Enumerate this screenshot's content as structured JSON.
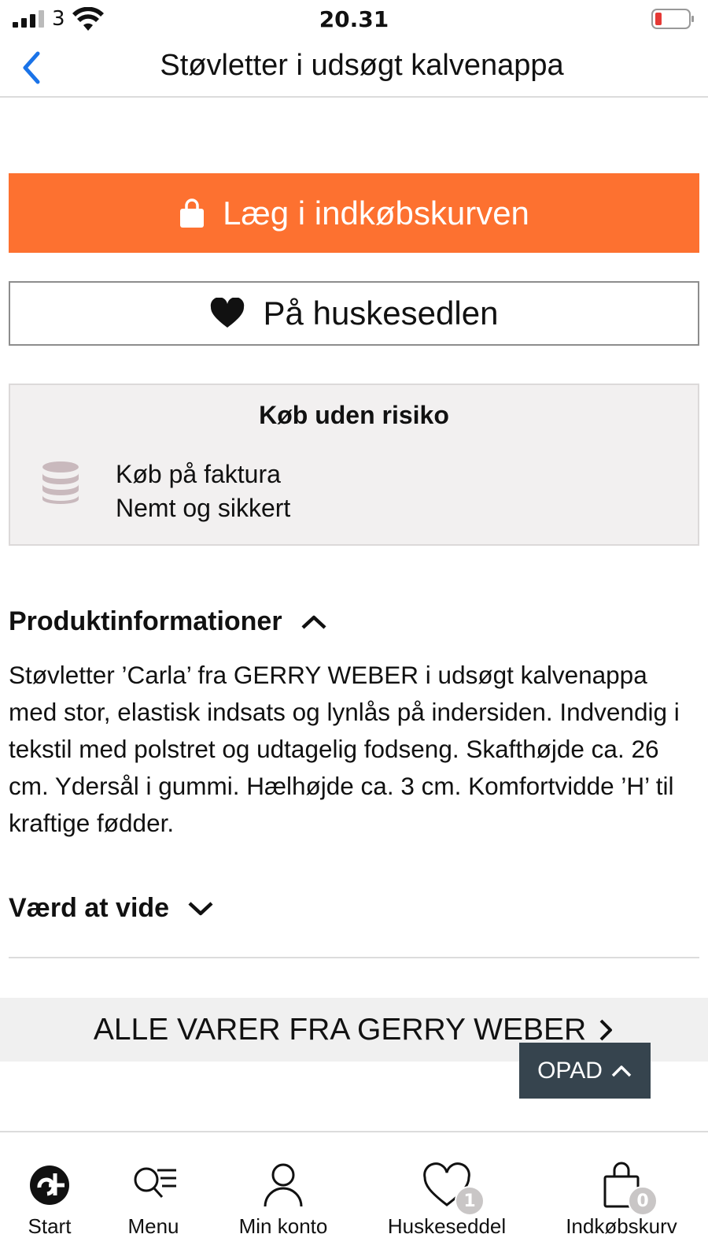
{
  "status_bar": {
    "carrier": "3",
    "time": "20.31"
  },
  "header": {
    "title": "Støvletter i udsøgt kalvenappa",
    "back_icon": "chevron-left-icon"
  },
  "actions": {
    "add_to_cart_label": "Læg i indkøbskurven",
    "wishlist_label": "På huskesedlen",
    "accent_color": "#fd7130"
  },
  "risk_free": {
    "title": "Køb uden risiko",
    "line1": "Køb på faktura",
    "line2": "Nemt og sikkert",
    "icon": "coins-icon"
  },
  "product_info": {
    "heading": "Produktinformationer",
    "expanded": true,
    "description": "Støvletter ’Carla’ fra GERRY WEBER i udsøgt kalvenappa med stor, elastisk indsats og lynlås på indersiden. Indvendig i tekstil med polstret og udtagelig fodseng. Skafthøjde ca. 26 cm. Ydersål i gummi. Hælhøjde ca. 3 cm. Komfortvidde ’H’ til kraftige fødder."
  },
  "good_to_know": {
    "heading": "Værd at vide",
    "expanded": false
  },
  "brand_link": {
    "label": "ALLE VARER FRA GERRY WEBER"
  },
  "scroll_top": {
    "label": "OPAD"
  },
  "tab_bar": {
    "tabs": [
      {
        "label": "Start",
        "icon": "logo-icon"
      },
      {
        "label": "Menu",
        "icon": "search-menu-icon"
      },
      {
        "label": "Min konto",
        "icon": "user-icon"
      },
      {
        "label": "Huskeseddel",
        "icon": "heart-icon",
        "badge": "1"
      },
      {
        "label": "Indkøbskurv",
        "icon": "shopping-bag-icon",
        "badge": "0"
      }
    ]
  }
}
